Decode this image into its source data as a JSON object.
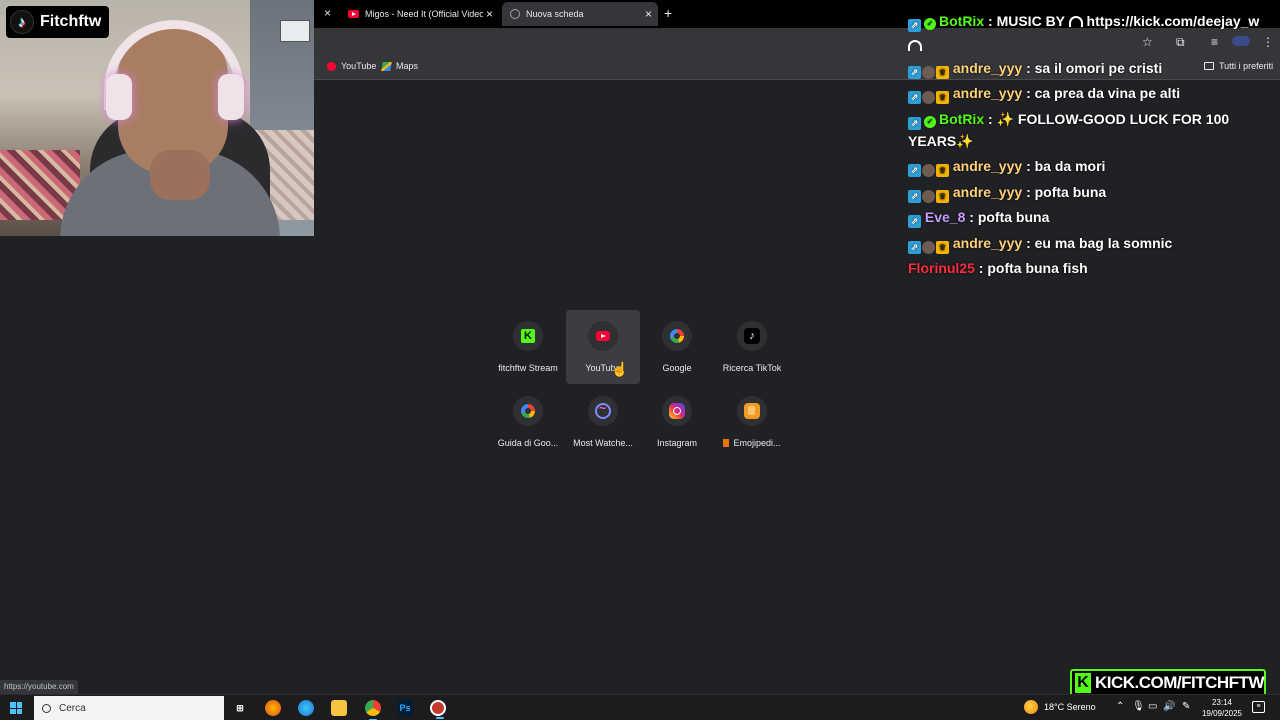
{
  "browser": {
    "tabs": [
      {
        "title": "Migos - Need It (Official Video)",
        "active": false
      },
      {
        "title": "Nuova scheda",
        "active": true
      }
    ],
    "new_tab_glyph": "+",
    "close_glyph": "×",
    "bookmarks": [
      {
        "label": "YouTube",
        "icon": "youtube-icon"
      },
      {
        "label": "Maps",
        "icon": "maps-icon"
      }
    ],
    "all_bookmarks_label": "Tutti i preferiti",
    "status_url": "https://youtube.com"
  },
  "webcam": {
    "channel_name": "Fitchftw",
    "logo_glyph": "♪"
  },
  "shortcuts": [
    {
      "label": "fitchftw Stream",
      "icon": "kick-icon",
      "glyph": "K"
    },
    {
      "label": "YouTube",
      "icon": "youtube-icon",
      "hovered": true
    },
    {
      "label": "Google",
      "icon": "google-icon"
    },
    {
      "label": "Ricerca TikTok",
      "icon": "tiktok-icon",
      "glyph": "♪"
    },
    {
      "label": "Guida di Goo...",
      "icon": "google-icon"
    },
    {
      "label": "Most Watche...",
      "icon": "most-watched-icon"
    },
    {
      "label": "Instagram",
      "icon": "instagram-icon"
    },
    {
      "label": "Emojipedi...",
      "icon": "emojipedia-icon"
    }
  ],
  "chat": {
    "messages": [
      {
        "user": "BotRix",
        "text": ": MUSIC BY",
        "tail": "https://kick.com/deejay_w",
        "color": "#53fc18"
      },
      {
        "user": "andre_yyy",
        "text": ": sa il omori pe cristi",
        "color": "#ffd27a"
      },
      {
        "user": "andre_yyy",
        "text": ": ca prea da vina pe alti",
        "color": "#ffd27a"
      },
      {
        "user": "BotRix",
        "text": ": ✨ FOLLOW-GOOD LUCK FOR 100 YEARS✨",
        "color": "#53fc18"
      },
      {
        "user": "andre_yyy",
        "text": ": ba da mori",
        "color": "#ffd27a"
      },
      {
        "user": "andre_yyy",
        "text": ": pofta buna",
        "color": "#ffd27a"
      },
      {
        "user": "Eve_8",
        "text": ": pofta buna",
        "color": "#c89bff"
      },
      {
        "user": "andre_yyy",
        "text": ": eu ma bag la somnic",
        "color": "#ffd27a"
      },
      {
        "user": "Florinul25",
        "text": ": pofta buna fish",
        "color": "#ff2d3f"
      }
    ]
  },
  "kick_banner": {
    "glyph": "K",
    "text": "KICK.COM/FITCHFTW"
  },
  "taskbar": {
    "search_placeholder": "Cerca",
    "weather": "18°C  Sereno",
    "time": "23:14",
    "date": "19/09/2025",
    "photoshop_label": "Ps",
    "accent": "#4cc2ff"
  }
}
